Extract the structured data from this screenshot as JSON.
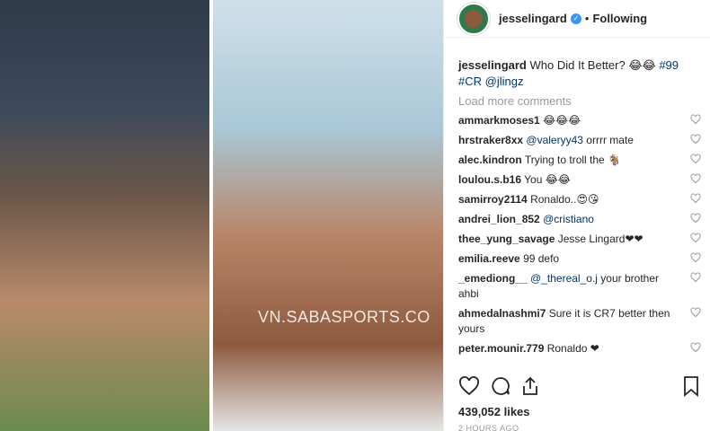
{
  "post": {
    "watermark": "VN.SABASPORTS.CO"
  },
  "header": {
    "username": "jesselingard",
    "separator": "•",
    "follow_status": "Following"
  },
  "caption": {
    "username": "jesselingard",
    "text": "Who Did It Better? 😂😂",
    "tags": "#99 #CR @jlingz"
  },
  "load_more": "Load more comments",
  "comments": [
    {
      "user": "ammarkmoses1",
      "text": "😂😂😂"
    },
    {
      "user": "hrstraker8xx",
      "mention": "@valeryy43",
      "text": "orrrr mate"
    },
    {
      "user": "alec.kindron",
      "text": "Trying to troll the 🐐"
    },
    {
      "user": "loulou.s.b16",
      "text": "You 😂😂"
    },
    {
      "user": "samirroy2114",
      "text": "Ronaldo..😍😘"
    },
    {
      "user": "andrei_lion_852",
      "mention": "@cristiano",
      "text": ""
    },
    {
      "user": "thee_yung_savage",
      "text": "Jesse Lingard❤❤"
    },
    {
      "user": "emilia.reeve",
      "text": "99 defo"
    },
    {
      "user": "_emediong__",
      "mention": "@_thereal_o.j",
      "text": "your brother ahbi"
    },
    {
      "user": "ahmedalnashmi7",
      "text": "Sure it is CR7 better then yours"
    },
    {
      "user": "peter.mounir.779",
      "text": "Ronaldo ❤"
    }
  ],
  "likes": "439,052 likes",
  "timestamp": "2 HOURS AGO",
  "icons": {
    "like": "heart-outline-icon",
    "comment": "comment-bubble-icon",
    "share": "share-icon",
    "save": "bookmark-icon",
    "verified": "verified-badge-icon"
  },
  "colors": {
    "link": "#003569",
    "verified": "#3897f0",
    "muted": "#999999"
  }
}
